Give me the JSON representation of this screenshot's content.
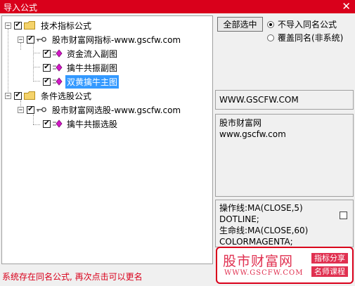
{
  "window": {
    "title": "导入公式",
    "close_glyph": "✕"
  },
  "tree": {
    "nodes": [
      {
        "label": "技术指标公式",
        "checked": true,
        "expander": "−"
      },
      {
        "label": "股市财富网指标-www.gscfw.com",
        "checked": true,
        "expander": "−"
      },
      {
        "label": "资金流入副图",
        "checked": true
      },
      {
        "label": "擒牛共振副图",
        "checked": true
      },
      {
        "label": "双黄擒牛主图",
        "checked": true,
        "selected": true
      },
      {
        "label": "条件选股公式",
        "checked": true,
        "expander": "−"
      },
      {
        "label": "股市财富网选股-www.gscfw.com",
        "checked": true,
        "expander": "−"
      },
      {
        "label": "擒牛共振选股",
        "checked": true
      }
    ]
  },
  "controls": {
    "select_all_label": "全部选中",
    "radio_skip_label": "不导入同名公式",
    "radio_overwrite_label": "覆盖同名(非系统)"
  },
  "panels": {
    "website": "WWW.GSCFW.COM",
    "description_line1": "股市财富网",
    "description_line2": "www.gscfw.com",
    "code_line1": "操作线:MA(CLOSE,5)",
    "code_line2": "DOTLINE;",
    "code_line3": "生命线:MA(CLOSE,60)",
    "code_line4": "COLORMAGENTA;"
  },
  "watermark": {
    "brand": "股市财富网",
    "url": "WWW.GSCFW.COM",
    "tag1": "指标分享",
    "tag2": "名师课程"
  },
  "status_text": "系统存在同名公式, 再次点击可以更名",
  "colors": {
    "title_bar": "#d9001b",
    "selection": "#3399ff",
    "status": "#d9001b",
    "watermark": "#e03050"
  }
}
